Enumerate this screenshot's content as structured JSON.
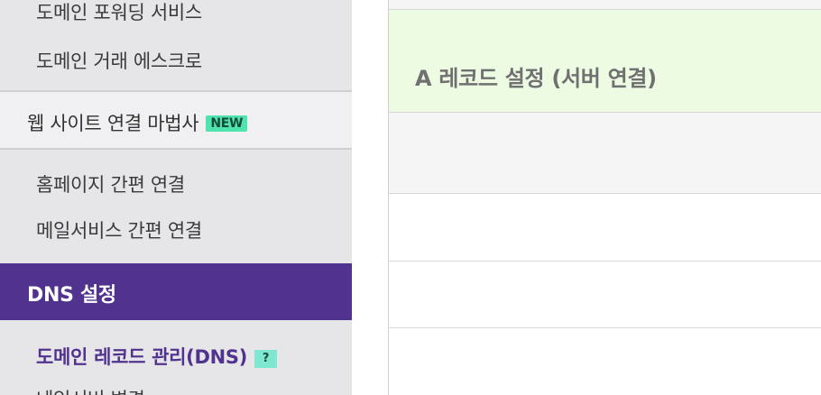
{
  "sidebar": {
    "items": [
      {
        "label": "도메인 포워딩 서비스"
      },
      {
        "label": "도메인 거래 에스크로"
      },
      {
        "label": "웹 사이트 연결 마법사",
        "badge": "NEW"
      },
      {
        "label": "홈페이지 간편 연결"
      },
      {
        "label": "메일서비스 간편 연결"
      },
      {
        "label": "DNS 설정"
      },
      {
        "label": "도메인 레코드 관리(DNS)",
        "badge": "?"
      },
      {
        "label": "네임서버 변경"
      }
    ]
  },
  "main": {
    "section_title": "A 레코드 설정 (서버 연결)"
  },
  "colors": {
    "accent": "#51328f",
    "sidebar_bg": "#e6e6e9",
    "section_bg": "#eefbe3",
    "badge_new": "#4fe3ae",
    "badge_help": "#7fe6cf"
  }
}
